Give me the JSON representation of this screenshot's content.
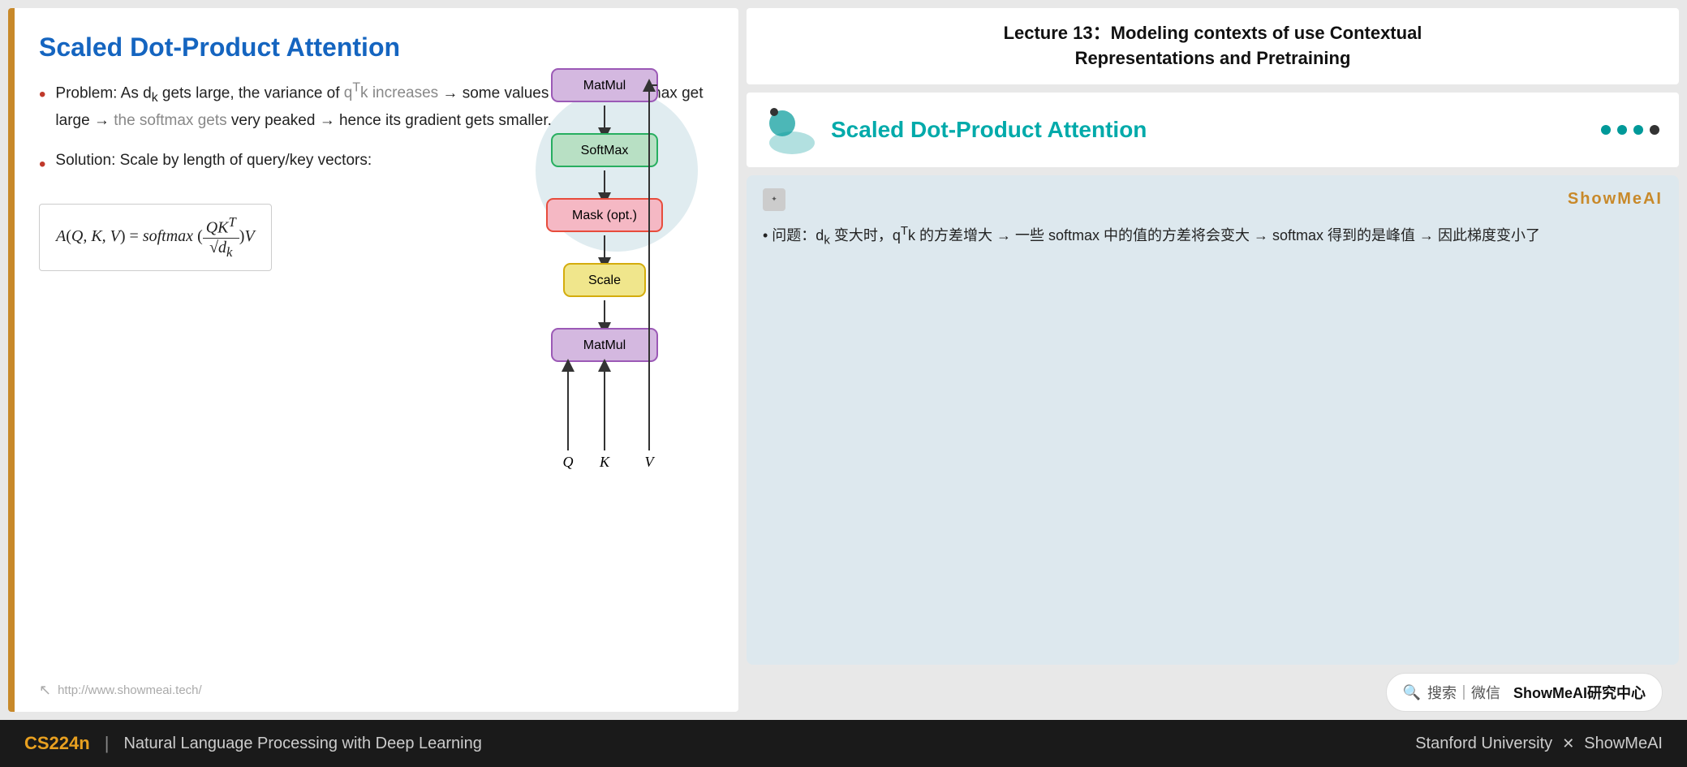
{
  "header": {
    "lecture_title": "Lecture 13：Modeling contexts of use Contextual\nRepresentations and Pretraining"
  },
  "slide": {
    "title": "Scaled Dot-Product Attention",
    "bullet1_prefix": "Problem: As d",
    "bullet1_sub": "k",
    "bullet1_suffix1": " gets large, the variance of q",
    "bullet1_sup": "T",
    "bullet1_suffix2": "k increases → some values inside the softmax get large → the softmax gets very peaked → hence its gradient gets smaller.",
    "bullet2_text": "Solution: Scale by length of query/key vectors:",
    "formula": "A(Q, K, V) = softmax(",
    "formula_num": "QK",
    "formula_sup": "T",
    "formula_den": "√d",
    "formula_den_sub": "k",
    "formula_end": ")V",
    "footer_url": "http://www.showmeai.tech/",
    "diagram": {
      "nodes": [
        {
          "id": "matmul_top",
          "label": "MatMul",
          "type": "purple"
        },
        {
          "id": "softmax",
          "label": "SoftMax",
          "type": "green"
        },
        {
          "id": "mask",
          "label": "Mask (opt.)",
          "type": "pink"
        },
        {
          "id": "scale",
          "label": "Scale",
          "type": "yellow"
        },
        {
          "id": "matmul_bot",
          "label": "MatMul",
          "type": "purple"
        }
      ],
      "qkv_labels": [
        "Q",
        "K",
        "V"
      ]
    }
  },
  "right_slide": {
    "title": "Scaled Dot-Product Attention",
    "dots": [
      "#00aaaa",
      "#00aaaa",
      "#00aaaa",
      "#333"
    ]
  },
  "annotation": {
    "showmeai_label": "ShowMeAI",
    "text": "• 问题：dₖ 变大时，qᵀk 的方差增大 → 一些 softmax 中的值的方差将会变大 → softmax 得到的是峰值 → 因此梯度变小了"
  },
  "search_bar": {
    "icon": "🔍",
    "text": "搜索 | 微信",
    "brand": "ShowMeAI研究中心"
  },
  "bottom_bar": {
    "course_code": "CS224n",
    "separator": "|",
    "course_name": "Natural Language Processing with Deep Learning",
    "right_text": "Stanford University",
    "x_symbol": "✕",
    "brand": "ShowMeAI"
  }
}
